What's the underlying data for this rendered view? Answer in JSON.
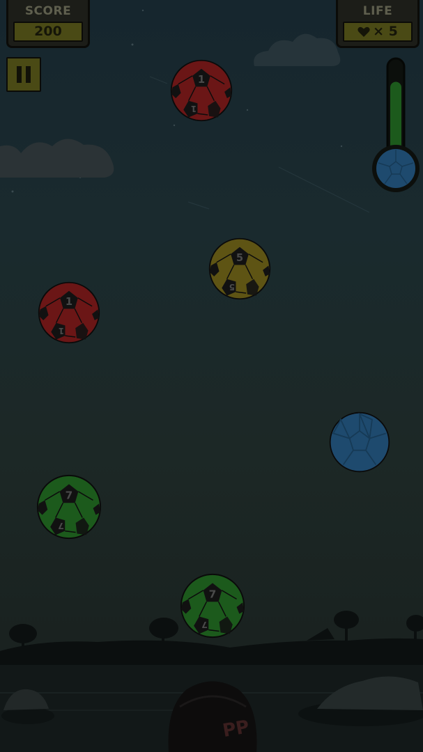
{
  "hud": {
    "score_label": "SCORE",
    "score_value": "200",
    "life_label": "LIFE",
    "life_icon": "heart-icon",
    "life_value": "× 5"
  },
  "controls": {
    "pause_icon": "pause-icon"
  },
  "power_gauge": {
    "level": 0.78,
    "fill_color": "#1c5a1c",
    "bulb_color": "#1e4a6e"
  },
  "balls": [
    {
      "color": "red",
      "number": "1",
      "hex": "#6b1616"
    },
    {
      "color": "yellow",
      "number": "5",
      "hex": "#5e5414"
    },
    {
      "color": "red",
      "number": "1",
      "hex": "#6b1616"
    },
    {
      "color": "blue",
      "number": "",
      "hex": "#1e4a6e"
    },
    {
      "color": "green",
      "number": "7",
      "hex": "#1c5a1c"
    },
    {
      "color": "green",
      "number": "7",
      "hex": "#1c5a1c"
    }
  ],
  "player": {
    "shirt_text": "PP"
  },
  "colors": {
    "hud_bg": "#1c1d18",
    "hud_accent": "#4a4a15",
    "hud_label": "#5f5f4e",
    "dim_overlay": "rgba(0,0,0,0.55)"
  }
}
